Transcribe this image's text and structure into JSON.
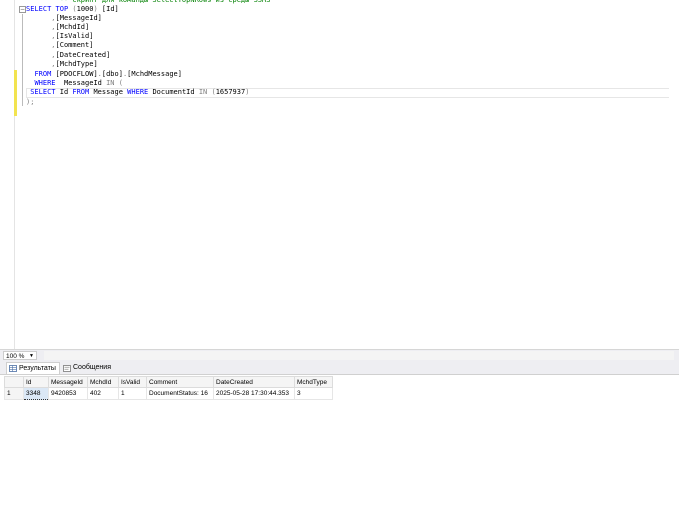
{
  "editor": {
    "lines": [
      {
        "id": "l0",
        "parts": [
          {
            "t": "        ",
            "c": ""
          },
          {
            "t": "-- скрипт для команды SelectTopNRows из среды SSMS",
            "c": "cm"
          }
        ]
      },
      {
        "id": "l1",
        "parts": [
          {
            "t": "SELECT",
            "c": "kw"
          },
          {
            "t": " ",
            "c": ""
          },
          {
            "t": "TOP",
            "c": "kw"
          },
          {
            "t": " (",
            "c": "op"
          },
          {
            "t": "1000",
            "c": "num"
          },
          {
            "t": ") ",
            "c": "op"
          },
          {
            "t": "[Id]",
            "c": ""
          }
        ]
      },
      {
        "id": "l2",
        "parts": [
          {
            "t": "      ",
            "c": ""
          },
          {
            "t": ",",
            "c": "op"
          },
          {
            "t": "[MessageId]",
            "c": ""
          }
        ]
      },
      {
        "id": "l3",
        "parts": [
          {
            "t": "      ",
            "c": ""
          },
          {
            "t": ",",
            "c": "op"
          },
          {
            "t": "[MchdId]",
            "c": ""
          }
        ]
      },
      {
        "id": "l4",
        "parts": [
          {
            "t": "      ",
            "c": ""
          },
          {
            "t": ",",
            "c": "op"
          },
          {
            "t": "[IsValid]",
            "c": ""
          }
        ]
      },
      {
        "id": "l5",
        "parts": [
          {
            "t": "      ",
            "c": ""
          },
          {
            "t": ",",
            "c": "op"
          },
          {
            "t": "[Comment]",
            "c": ""
          }
        ]
      },
      {
        "id": "l6",
        "parts": [
          {
            "t": "      ",
            "c": ""
          },
          {
            "t": ",",
            "c": "op"
          },
          {
            "t": "[DateCreated]",
            "c": ""
          }
        ]
      },
      {
        "id": "l7",
        "parts": [
          {
            "t": "      ",
            "c": ""
          },
          {
            "t": ",",
            "c": "op"
          },
          {
            "t": "[MchdType]",
            "c": ""
          }
        ]
      },
      {
        "id": "l8",
        "parts": [
          {
            "t": "  ",
            "c": ""
          },
          {
            "t": "FROM",
            "c": "kw"
          },
          {
            "t": " [PDOCFLOW]",
            "c": ""
          },
          {
            "t": ".",
            "c": "op"
          },
          {
            "t": "[dbo]",
            "c": ""
          },
          {
            "t": ".",
            "c": "op"
          },
          {
            "t": "[MchdMessage]",
            "c": ""
          }
        ]
      },
      {
        "id": "l9",
        "parts": [
          {
            "t": "  ",
            "c": ""
          },
          {
            "t": "WHERE",
            "c": "kw"
          },
          {
            "t": "  MessageId ",
            "c": ""
          },
          {
            "t": "IN",
            "c": "op"
          },
          {
            "t": " (",
            "c": "op"
          }
        ]
      },
      {
        "id": "l10",
        "parts": [
          {
            "t": " ",
            "c": ""
          },
          {
            "t": "SELECT",
            "c": "kw"
          },
          {
            "t": " Id ",
            "c": ""
          },
          {
            "t": "FROM",
            "c": "kw"
          },
          {
            "t": " Message ",
            "c": ""
          },
          {
            "t": "WHERE",
            "c": "kw"
          },
          {
            "t": " DocumentId ",
            "c": ""
          },
          {
            "t": "IN",
            "c": "op"
          },
          {
            "t": " (",
            "c": "op"
          },
          {
            "t": "1657937",
            "c": "num"
          },
          {
            "t": ")",
            "c": "op"
          }
        ]
      },
      {
        "id": "l11",
        "parts": [
          {
            "t": ");",
            "c": "op"
          }
        ]
      }
    ]
  },
  "zoom": {
    "value": "100 %"
  },
  "tabs": [
    {
      "label": "Результаты",
      "icon": "grid-icon"
    },
    {
      "label": "Сообщения",
      "icon": "messages-icon"
    }
  ],
  "grid": {
    "columns": [
      "Id",
      "MessageId",
      "MchdId",
      "IsValid",
      "Comment",
      "DateCreated",
      "MchdType"
    ],
    "rows": [
      {
        "num": "1",
        "cells": [
          "3348",
          "9420853",
          "402",
          "1",
          "DocumentStatus: 16",
          "2025-05-28 17:30:44.353",
          "3"
        ]
      }
    ]
  },
  "colors": {
    "keyword": "#0000ff",
    "operator": "#808080",
    "comment": "#008000",
    "change_marker": "#f2e34f"
  }
}
